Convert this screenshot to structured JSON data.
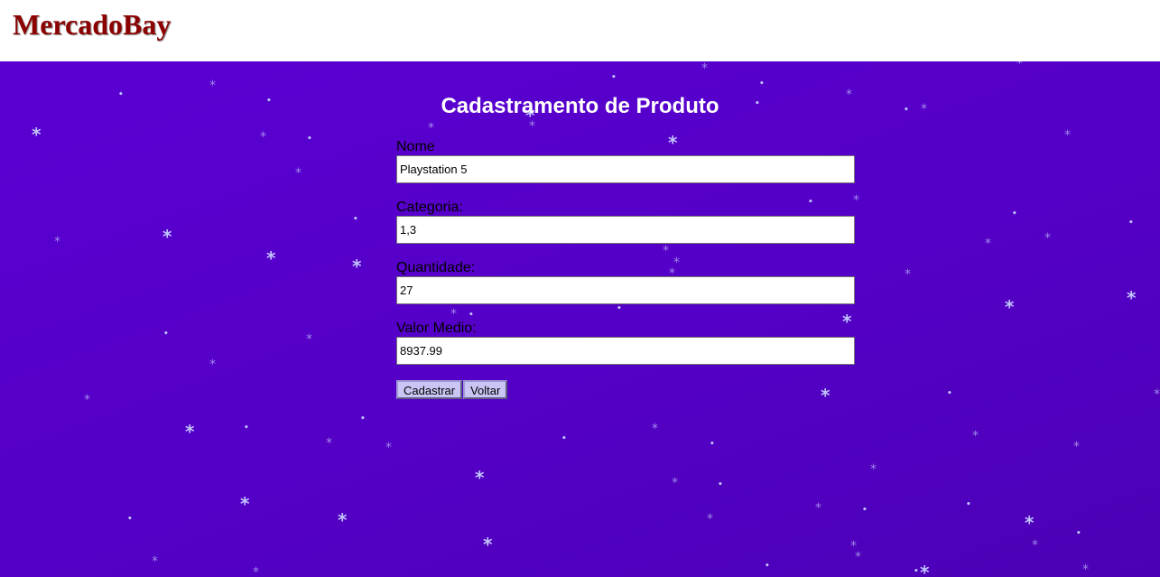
{
  "header": {
    "brand": "MercadoBay"
  },
  "form": {
    "title": "Cadastramento de Produto",
    "fields": [
      {
        "label": "Nome",
        "value": "Playstation 5"
      },
      {
        "label": "Categoria:",
        "value": "1,3"
      },
      {
        "label": "Quantidade:",
        "value": "27"
      },
      {
        "label": "Valor Medio:",
        "value": "8937.99"
      }
    ],
    "submit_label": "Cadastrar",
    "back_label": "Voltar"
  },
  "colors": {
    "brand": "#8b0000",
    "background": "#5500cc",
    "button": "#c9c5f5"
  },
  "decoration": {
    "snowflake_icon": "snowflake-icon"
  }
}
